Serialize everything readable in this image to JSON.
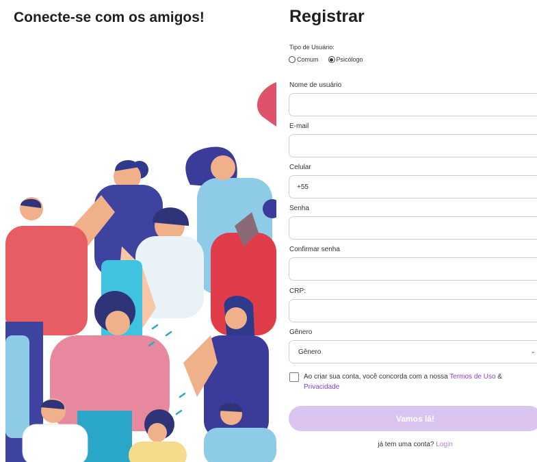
{
  "left": {
    "title": "Conecte-se com os amigos!"
  },
  "form": {
    "title": "Registrar",
    "user_type": {
      "label": "Tipo de Usuário:",
      "options": [
        {
          "label": "Comum",
          "selected": false
        },
        {
          "label": "Psicólogo",
          "selected": true
        }
      ]
    },
    "fields": {
      "username": {
        "label": "Nome de usuário",
        "value": ""
      },
      "email": {
        "label": "E-mail",
        "value": ""
      },
      "phone": {
        "label": "Celular",
        "value": "+55"
      },
      "password": {
        "label": "Senha",
        "value": ""
      },
      "confirm_password": {
        "label": "Confirmar senha",
        "value": ""
      },
      "crp": {
        "label": "CRP:",
        "value": ""
      },
      "gender": {
        "label": "Gênero",
        "selected": "Gênero"
      }
    },
    "terms": {
      "checked": false,
      "prefix": "Ao criar sua conta, você concorda com a nossa ",
      "terms_link": "Termos de Uso",
      "connector": " & ",
      "privacy_link": "Privacidade"
    },
    "submit_label": "Vamos lá!",
    "login_prompt": "já tem uma conta?",
    "login_link": "Login"
  },
  "colors": {
    "accent": "#8a3fd1",
    "button": "#dcc4f1"
  }
}
